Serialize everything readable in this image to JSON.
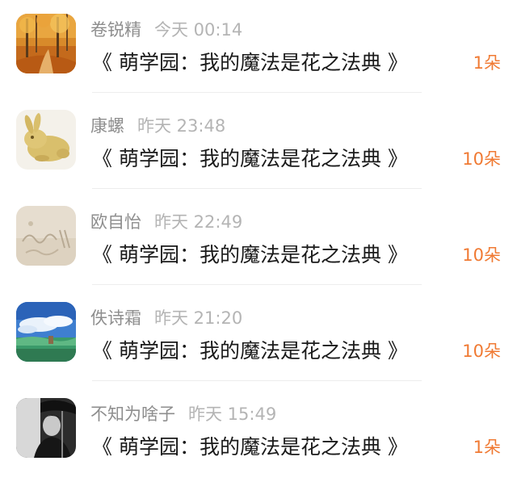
{
  "items": [
    {
      "name": "卷锐精",
      "time": "今天 00:14",
      "title": "《 萌学园：我的魔法是花之法典 》",
      "gift": "1朵",
      "avatar_icon": "autumn-forest-avatar"
    },
    {
      "name": "康螺",
      "time": "昨天 23:48",
      "title": "《 萌学园：我的魔法是花之法典 》",
      "gift": "10朵",
      "avatar_icon": "rabbit-figurine-avatar"
    },
    {
      "name": "欧自怡",
      "time": "昨天 22:49",
      "title": "《 萌学园：我的魔法是花之法典 》",
      "gift": "10朵",
      "avatar_icon": "sand-writing-avatar"
    },
    {
      "name": "佚诗霜",
      "time": "昨天 21:20",
      "title": "《 萌学园：我的魔法是花之法典 》",
      "gift": "10朵",
      "avatar_icon": "anime-sky-avatar"
    },
    {
      "name": "不知为啥子",
      "time": "昨天 15:49",
      "title": "《 萌学园：我的魔法是花之法典 》",
      "gift": "1朵",
      "avatar_icon": "umbrella-boy-avatar"
    }
  ],
  "colors": {
    "gift_accent": "#f07a33",
    "name_gray": "#8e8e8e",
    "time_gray": "#b4b4b4",
    "title_text": "#1a1a1a"
  }
}
